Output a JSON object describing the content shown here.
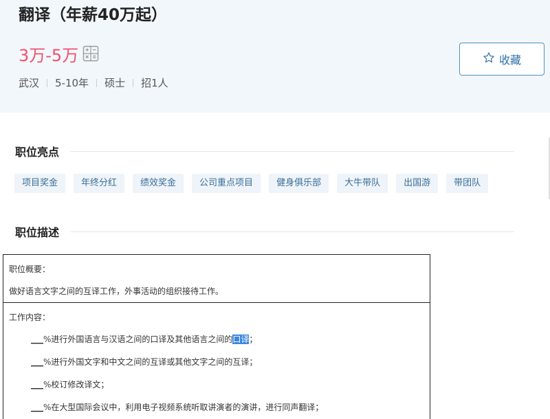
{
  "job": {
    "title": "翻译（年薪40万起）",
    "salary": "3万-5万",
    "meta": [
      "武汉",
      "5-10年",
      "硕士",
      "招1人"
    ],
    "favorite_label": "收藏"
  },
  "highlights": {
    "title": "职位亮点",
    "tags": [
      "项目奖金",
      "年终分红",
      "绩效奖金",
      "公司重点项目",
      "健身俱乐部",
      "大牛带队",
      "出国游",
      "带团队"
    ]
  },
  "description": {
    "title": "职位描述",
    "overview_label": "职位概要：",
    "overview_text": "做好语言文字之间的互译工作，外事活动的组织接待工作。",
    "content_label": "工作内容：",
    "duties": [
      {
        "blank": "___",
        "prefix": "%进行外国语言与汉语之间的口译及其他语言之间的",
        "highlight": "口译",
        "suffix": "；"
      },
      {
        "blank": "___",
        "prefix": "%进行外国文字和中文之间的互译或其他文字之间的互译；",
        "highlight": "",
        "suffix": ""
      },
      {
        "blank": "___",
        "prefix": "%校订修改译文；",
        "highlight": "",
        "suffix": ""
      },
      {
        "blank": "___",
        "prefix": "%在大型国际会议中，利用电子视频系统听取讲演者的演讲，进行同声翻译；",
        "highlight": "",
        "suffix": ""
      }
    ]
  },
  "colors": {
    "salary": "#f0506e",
    "header_bg": "#f2f7fb",
    "tag_bg": "#eef4f9",
    "button_border": "#4a90c2",
    "selection": "#3b86e0"
  },
  "icons": {
    "salary_calc": "calculator-icon",
    "favorite": "star-icon"
  }
}
